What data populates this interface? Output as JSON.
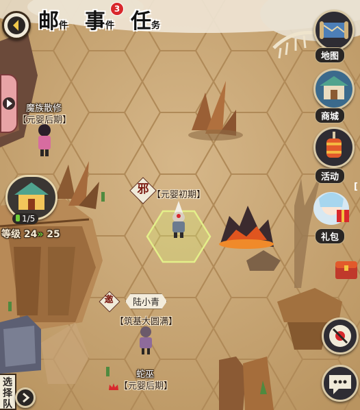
{
  "top_tabs": [
    {
      "big": "邮",
      "small": "件"
    },
    {
      "big": "事",
      "small": "件"
    },
    {
      "big": "任",
      "small": "务"
    }
  ],
  "event_badge": "3",
  "right_menu": {
    "map": "地图",
    "shop": "商城",
    "activity": "活动",
    "gift": "礼包",
    "partial_bracket": "["
  },
  "npcs": {
    "demon": {
      "name": "魔族散修",
      "realm": "【元婴后期】"
    },
    "evil": {
      "mark": "邪",
      "realm": "【元婴初期】"
    },
    "lu": {
      "invite": "邀",
      "name": "陆小青",
      "realm": "【筑基大圆满】"
    },
    "snake": {
      "name": "蛇巫",
      "realm": "【元婴后期】"
    }
  },
  "sect": {
    "count": "1/5",
    "level_label": "等级",
    "level_from": "24",
    "level_to": "25"
  },
  "select_team": {
    "line1": "选择",
    "line2": "队"
  },
  "colors": {
    "sand": "#c9a979",
    "hex_line": "#b58f5e",
    "highlight": "#d8e87a",
    "panel_dark": "#2a2624",
    "accent_red": "#d8282c",
    "level_green": "#6fce3b"
  }
}
